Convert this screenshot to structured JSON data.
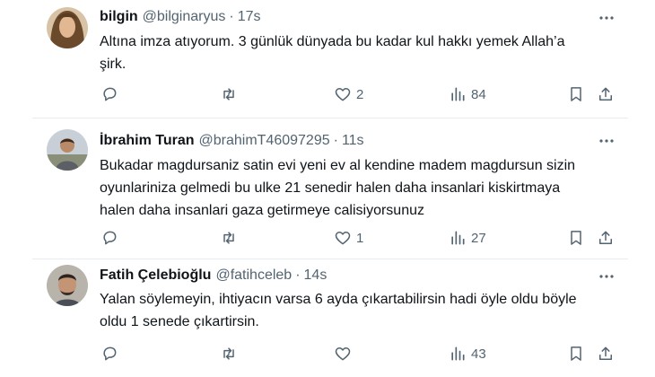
{
  "tweets": [
    {
      "name": "bilgin",
      "handle": "@bilginaryus",
      "dot": "·",
      "time": "17s",
      "lines": [
        "Altına imza atıyorum. 3 günlük dünyada bu kadar kul hakkı yemek Allah’a",
        "şirk."
      ],
      "replies": "",
      "retweets": "",
      "likes": "2",
      "views": "84"
    },
    {
      "name": "İbrahim Turan",
      "handle": "@brahimT46097295",
      "dot": "·",
      "time": "11s",
      "lines": [
        "Bukadar magdursaniz satin evi yeni ev al kendine madem magdursun sizin",
        "oyunlariniza gelmedi bu ulke 21 senedir halen daha insanlari kiskirtmaya",
        "halen daha insanlari gaza getirmeye calisiyorsunuz"
      ],
      "replies": "",
      "retweets": "",
      "likes": "1",
      "views": "27"
    },
    {
      "name": "Fatih Çelebioğlu",
      "handle": "@fatihceleb",
      "dot": "·",
      "time": "14s",
      "lines": [
        "Yalan söylemeyin, ihtiyacın varsa 6 ayda çıkartabilirsin hadi öyle oldu böyle",
        "oldu 1 senede çıkartirsin."
      ],
      "replies": "",
      "retweets": "",
      "likes": "",
      "views": "43"
    }
  ],
  "colors": {
    "text": "#0f1419",
    "secondary": "#536471",
    "divider": "#e6ecf0",
    "background": "#ffffff"
  },
  "icons": {
    "reply": "reply-icon",
    "retweet": "retweet-icon",
    "like": "heart-icon",
    "views": "views-icon",
    "bookmark": "bookmark-icon",
    "share": "share-icon",
    "more": "more-icon"
  }
}
